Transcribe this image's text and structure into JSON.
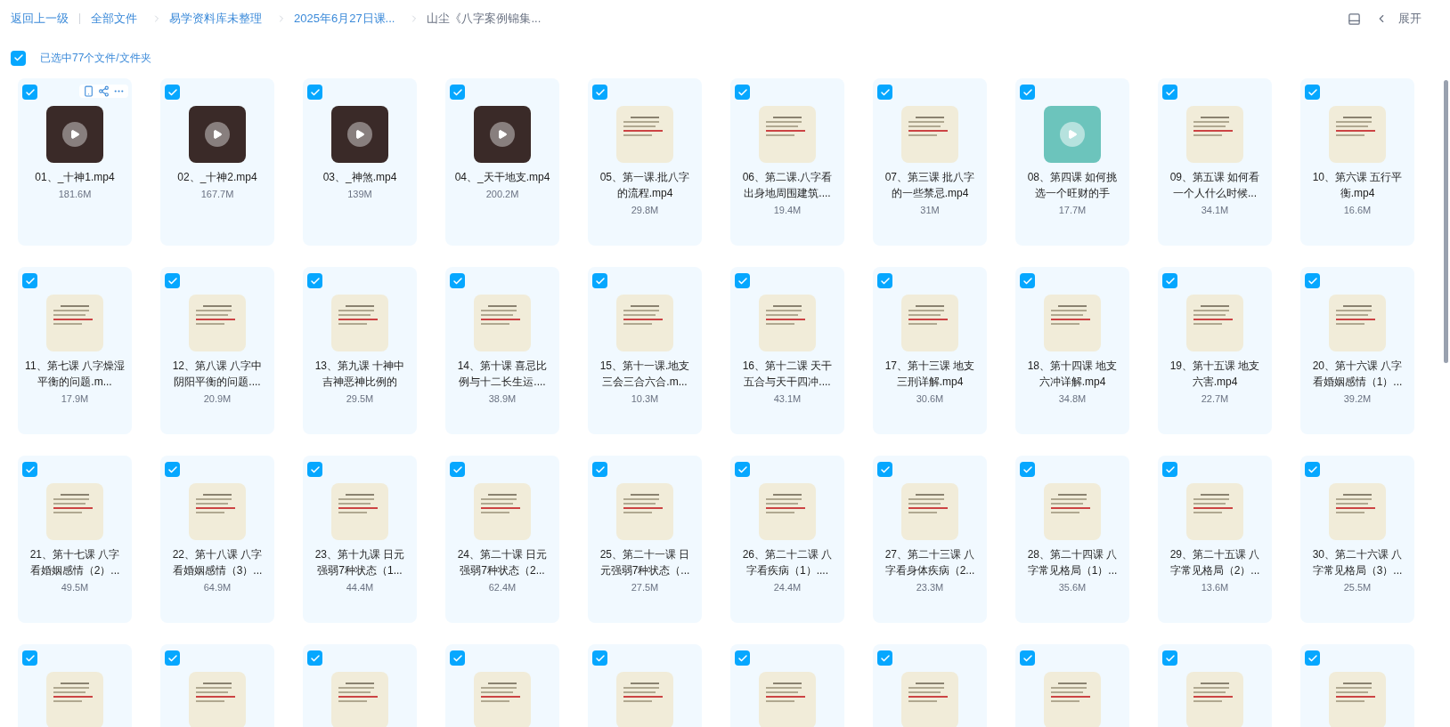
{
  "breadcrumb": {
    "back": "返回上一级",
    "items": [
      {
        "label": "全部文件",
        "current": false
      },
      {
        "label": "易学资料库未整理",
        "current": false
      },
      {
        "label": "2025年6月27日课...",
        "current": false
      },
      {
        "label": "山尘《八字案例锦集...",
        "current": true
      }
    ]
  },
  "toolbar": {
    "expand": "展开"
  },
  "selection": {
    "checked": true,
    "label": "已选中77个文件/文件夹"
  },
  "files": [
    {
      "name": "01、_十神1.mp4",
      "size": "181.6M",
      "kind": "video",
      "checked": true,
      "actions": true
    },
    {
      "name": "02、_十神2.mp4",
      "size": "167.7M",
      "kind": "video",
      "checked": true,
      "actions": false
    },
    {
      "name": "03、_神煞.mp4",
      "size": "139M",
      "kind": "video",
      "checked": true,
      "actions": false
    },
    {
      "name": "04、_天干地支.mp4",
      "size": "200.2M",
      "kind": "video",
      "checked": true,
      "actions": false
    },
    {
      "name": "05、第一课.批八字的流程.mp4",
      "size": "29.8M",
      "kind": "doc",
      "checked": true,
      "actions": false
    },
    {
      "name": "06、第二课.八字看出身地周围建筑....",
      "size": "19.4M",
      "kind": "doc",
      "checked": true,
      "actions": false
    },
    {
      "name": "07、第三课 批八字的一些禁忌.mp4",
      "size": "31M",
      "kind": "doc",
      "checked": true,
      "actions": false
    },
    {
      "name": "08、第四课 如何挑选一个旺财的手",
      "size": "17.7M",
      "kind": "slide",
      "checked": true,
      "actions": false
    },
    {
      "name": "09、第五课 如何看一个人什么时候...",
      "size": "34.1M",
      "kind": "doc",
      "checked": true,
      "actions": false
    },
    {
      "name": "10、第六课 五行平衡.mp4",
      "size": "16.6M",
      "kind": "doc",
      "checked": true,
      "actions": false
    },
    {
      "name": "11、第七课 八字燥湿平衡的问题.m...",
      "size": "17.9M",
      "kind": "doc",
      "checked": true,
      "actions": false
    },
    {
      "name": "12、第八课 八字中阴阳平衡的问题....",
      "size": "20.9M",
      "kind": "doc",
      "checked": true,
      "actions": false
    },
    {
      "name": "13、第九课 十神中吉神恶神比例的",
      "size": "29.5M",
      "kind": "doc",
      "checked": true,
      "actions": false
    },
    {
      "name": "14、第十课 喜忌比例与十二长生运....",
      "size": "38.9M",
      "kind": "doc",
      "checked": true,
      "actions": false
    },
    {
      "name": "15、第十一课.地支三会三合六合.m...",
      "size": "10.3M",
      "kind": "doc",
      "checked": true,
      "actions": false
    },
    {
      "name": "16、第十二课 天干五合与天干四冲....",
      "size": "43.1M",
      "kind": "doc",
      "checked": true,
      "actions": false
    },
    {
      "name": "17、第十三课 地支三刑详解.mp4",
      "size": "30.6M",
      "kind": "doc",
      "checked": true,
      "actions": false
    },
    {
      "name": "18、第十四课 地支六冲详解.mp4",
      "size": "34.8M",
      "kind": "doc",
      "checked": true,
      "actions": false
    },
    {
      "name": "19、第十五课 地支六害.mp4",
      "size": "22.7M",
      "kind": "doc",
      "checked": true,
      "actions": false
    },
    {
      "name": "20、第十六课 八字看婚姻感情（1）...",
      "size": "39.2M",
      "kind": "doc",
      "checked": true,
      "actions": false
    },
    {
      "name": "21、第十七课 八字看婚姻感情（2）...",
      "size": "49.5M",
      "kind": "doc",
      "checked": true,
      "actions": false
    },
    {
      "name": "22、第十八课 八字看婚姻感情（3）...",
      "size": "64.9M",
      "kind": "doc",
      "checked": true,
      "actions": false
    },
    {
      "name": "23、第十九课 日元强弱7种状态（1...",
      "size": "44.4M",
      "kind": "doc",
      "checked": true,
      "actions": false
    },
    {
      "name": "24、第二十课 日元强弱7种状态（2...",
      "size": "62.4M",
      "kind": "doc",
      "checked": true,
      "actions": false
    },
    {
      "name": "25、第二十一课 日元强弱7种状态（...",
      "size": "27.5M",
      "kind": "doc",
      "checked": true,
      "actions": false
    },
    {
      "name": "26、第二十二课 八字看疾病（1）....",
      "size": "24.4M",
      "kind": "doc",
      "checked": true,
      "actions": false
    },
    {
      "name": "27、第二十三课 八字看身体疾病（2...",
      "size": "23.3M",
      "kind": "doc",
      "checked": true,
      "actions": false
    },
    {
      "name": "28、第二十四课 八字常见格局（1）...",
      "size": "35.6M",
      "kind": "doc",
      "checked": true,
      "actions": false
    },
    {
      "name": "29、第二十五课 八字常见格局（2）...",
      "size": "13.6M",
      "kind": "doc",
      "checked": true,
      "actions": false
    },
    {
      "name": "30、第二十六课 八字常见格局（3）...",
      "size": "25.5M",
      "kind": "doc",
      "checked": true,
      "actions": false
    },
    {
      "kind": "doc",
      "checked": true,
      "actions": false
    },
    {
      "kind": "doc",
      "checked": true,
      "actions": false
    },
    {
      "kind": "doc",
      "checked": true,
      "actions": false
    },
    {
      "kind": "doc",
      "checked": true,
      "actions": false
    },
    {
      "kind": "doc",
      "checked": true,
      "actions": false
    },
    {
      "kind": "doc",
      "checked": true,
      "actions": false
    },
    {
      "kind": "doc",
      "checked": true,
      "actions": false
    },
    {
      "kind": "doc",
      "checked": true,
      "actions": false
    },
    {
      "kind": "doc",
      "checked": true,
      "actions": false
    },
    {
      "kind": "doc",
      "checked": true,
      "actions": false
    }
  ]
}
